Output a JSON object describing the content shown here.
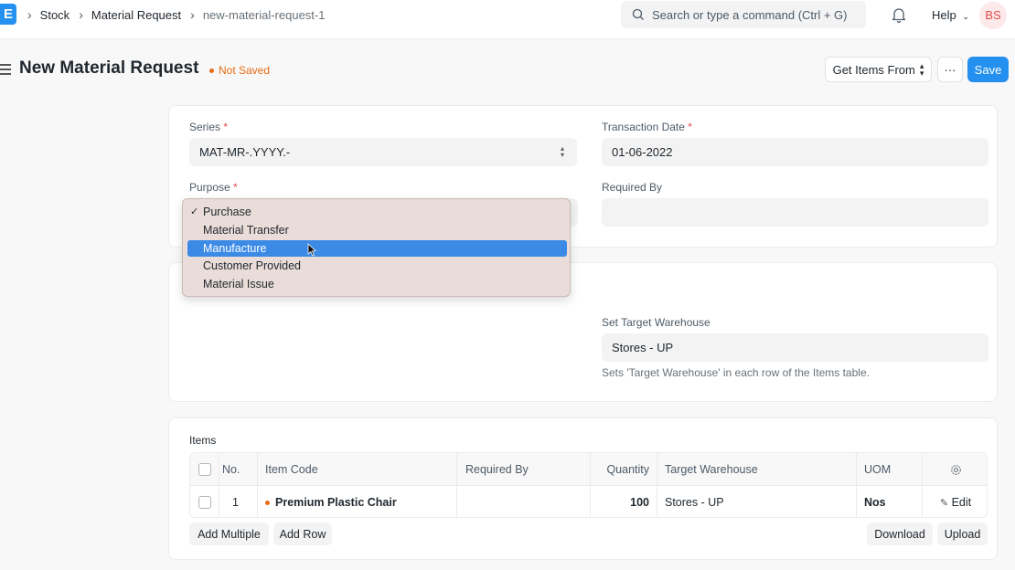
{
  "navbar": {
    "logo_text": "E",
    "breadcrumbs": [
      "Stock",
      "Material Request",
      "new-material-request-1"
    ],
    "search_placeholder": "Search or type a command (Ctrl + G)",
    "help_label": "Help",
    "avatar_initials": "BS"
  },
  "page": {
    "title": "New Material Request",
    "status": "Not Saved",
    "get_items_label": "Get Items From",
    "more_label": "···",
    "save_label": "Save"
  },
  "form": {
    "series_label": "Series",
    "series_value": "MAT-MR-.YYYY.-",
    "transaction_date_label": "Transaction Date",
    "transaction_date_value": "01-06-2022",
    "purpose_label": "Purpose",
    "required_by_label": "Required By",
    "required_by_value": "",
    "target_warehouse_label": "Set Target Warehouse",
    "target_warehouse_value": "Stores - UP",
    "target_warehouse_help": "Sets 'Target Warehouse' in each row of the Items table.",
    "required_marker": "*"
  },
  "purpose_dropdown": {
    "options": [
      "Purchase",
      "Material Transfer",
      "Manufacture",
      "Customer Provided",
      "Material Issue"
    ],
    "checked": "Purchase",
    "highlighted": "Manufacture",
    "check_mark": "✓"
  },
  "items": {
    "section_label": "Items",
    "columns": [
      "No.",
      "Item Code",
      "Required By",
      "Quantity",
      "Target Warehouse",
      "UOM"
    ],
    "rows": [
      {
        "no": "1",
        "item_code": "Premium Plastic Chair",
        "required_by": "",
        "quantity": "100",
        "target_warehouse": "Stores - UP",
        "uom": "Nos",
        "edit_label": "Edit"
      }
    ],
    "add_multiple_label": "Add Multiple",
    "add_row_label": "Add Row",
    "download_label": "Download",
    "upload_label": "Upload"
  },
  "colors": {
    "primary": "#2490ef",
    "not_saved": "#e86c13",
    "required": "#e24c4c",
    "dropdown_highlight": "#3b8ae6",
    "item_dot": "#e86c13"
  }
}
